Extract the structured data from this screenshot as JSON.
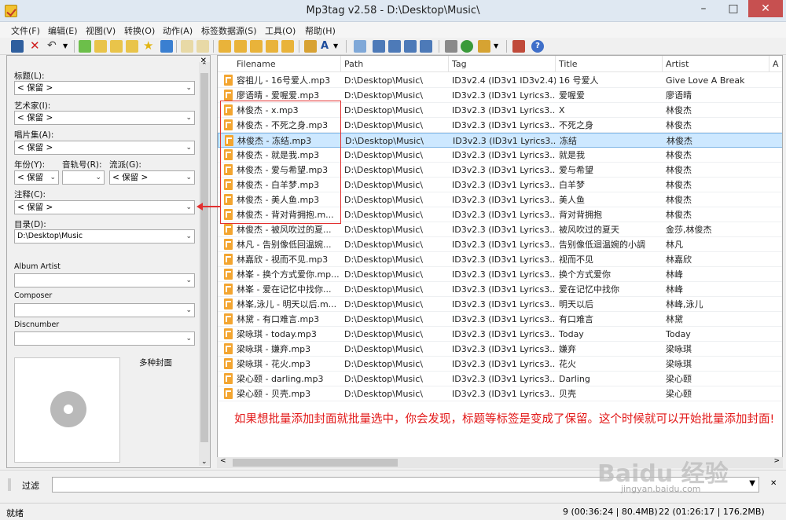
{
  "window": {
    "title": "Mp3tag v2.58  -  D:\\Desktop\\Music\\"
  },
  "menu": [
    "文件(F)",
    "编辑(E)",
    "视图(V)",
    "转换(O)",
    "动作(A)",
    "标签数据源(S)",
    "工具(O)",
    "帮助(H)"
  ],
  "tag_panel": {
    "title_label": "标题(L):",
    "title_value": "< 保留 >",
    "artist_label": "艺术家(I):",
    "artist_value": "< 保留 >",
    "album_label": "唱片集(A):",
    "album_value": "< 保留 >",
    "year_label": "年份(Y):",
    "year_value": "< 保留",
    "track_label": "音轨号(R):",
    "track_value": "",
    "genre_label": "流派(G):",
    "genre_value": "< 保留 >",
    "comment_label": "注释(C):",
    "comment_value": "< 保留 >",
    "dir_label": "目录(D):",
    "dir_value": "D:\\Desktop\\Music",
    "album_artist_label": "Album Artist",
    "album_artist_value": "",
    "composer_label": "Composer",
    "composer_value": "",
    "discnumber_label": "Discnumber",
    "discnumber_value": "",
    "cover_label": "多种封面"
  },
  "file_list": {
    "columns": [
      "Filename",
      "Path",
      "Tag",
      "Title",
      "Artist",
      "A"
    ],
    "rows": [
      {
        "filename": "容祖儿 - 16号爱人.mp3",
        "path": "D:\\Desktop\\Music\\",
        "tag": "ID3v2.4 (ID3v1 ID3v2.4)",
        "title": "16 号爱人",
        "artist": "Give Love A Break",
        "selected": false
      },
      {
        "filename": "廖语晴 - 爱喔爱.mp3",
        "path": "D:\\Desktop\\Music\\",
        "tag": "ID3v2.3 (ID3v1 Lyrics3...",
        "title": "爱喔爱",
        "artist": "廖语晴",
        "selected": false
      },
      {
        "filename": "林俊杰 - x.mp3",
        "path": "D:\\Desktop\\Music\\",
        "tag": "ID3v2.3 (ID3v1 Lyrics3...",
        "title": "X",
        "artist": "林俊杰",
        "selected": false
      },
      {
        "filename": "林俊杰 - 不死之身.mp3",
        "path": "D:\\Desktop\\Music\\",
        "tag": "ID3v2.3 (ID3v1 Lyrics3...",
        "title": "不死之身",
        "artist": "林俊杰",
        "selected": false
      },
      {
        "filename": "林俊杰 - 冻结.mp3",
        "path": "D:\\Desktop\\Music\\",
        "tag": "ID3v2.3 (ID3v1 Lyrics3...",
        "title": "冻结",
        "artist": "林俊杰",
        "selected": true
      },
      {
        "filename": "林俊杰 - 就是我.mp3",
        "path": "D:\\Desktop\\Music\\",
        "tag": "ID3v2.3 (ID3v1 Lyrics3...",
        "title": "就是我",
        "artist": "林俊杰",
        "selected": false
      },
      {
        "filename": "林俊杰 - 爱与希望.mp3",
        "path": "D:\\Desktop\\Music\\",
        "tag": "ID3v2.3 (ID3v1 Lyrics3...",
        "title": "爱与希望",
        "artist": "林俊杰",
        "selected": false
      },
      {
        "filename": "林俊杰 - 白羊梦.mp3",
        "path": "D:\\Desktop\\Music\\",
        "tag": "ID3v2.3 (ID3v1 Lyrics3...",
        "title": "白羊梦",
        "artist": "林俊杰",
        "selected": false
      },
      {
        "filename": "林俊杰 - 美人鱼.mp3",
        "path": "D:\\Desktop\\Music\\",
        "tag": "ID3v2.3 (ID3v1 Lyrics3...",
        "title": "美人鱼",
        "artist": "林俊杰",
        "selected": false
      },
      {
        "filename": "林俊杰 - 背对背拥抱.m...",
        "path": "D:\\Desktop\\Music\\",
        "tag": "ID3v2.3 (ID3v1 Lyrics3...",
        "title": "背对背拥抱",
        "artist": "林俊杰",
        "selected": false
      },
      {
        "filename": "林俊杰 - 被风吹过的夏...",
        "path": "D:\\Desktop\\Music\\",
        "tag": "ID3v2.3 (ID3v1 Lyrics3...",
        "title": "被风吹过的夏天",
        "artist": "金莎,林俊杰",
        "selected": false
      },
      {
        "filename": "林凡 - 告别像低回温婉...",
        "path": "D:\\Desktop\\Music\\",
        "tag": "ID3v2.3 (ID3v1 Lyrics3...",
        "title": "告别像低迴温婉的小調",
        "artist": "林凡",
        "selected": false
      },
      {
        "filename": "林嘉欣 - 视而不见.mp3",
        "path": "D:\\Desktop\\Music\\",
        "tag": "ID3v2.3 (ID3v1 Lyrics3...",
        "title": "视而不见",
        "artist": "林嘉欣",
        "selected": false
      },
      {
        "filename": "林峯 - 换个方式爱你.mp...",
        "path": "D:\\Desktop\\Music\\",
        "tag": "ID3v2.3 (ID3v1 Lyrics3...",
        "title": "换个方式爱你",
        "artist": "林峰",
        "selected": false
      },
      {
        "filename": "林峯 - 爱在记忆中找你...",
        "path": "D:\\Desktop\\Music\\",
        "tag": "ID3v2.3 (ID3v1 Lyrics3...",
        "title": "爱在记忆中找你",
        "artist": "林峰",
        "selected": false
      },
      {
        "filename": "林峯,泳儿 - 明天以后.m...",
        "path": "D:\\Desktop\\Music\\",
        "tag": "ID3v2.3 (ID3v1 Lyrics3...",
        "title": "明天以后",
        "artist": "林峰,泳儿",
        "selected": false
      },
      {
        "filename": "林黛 - 有口难言.mp3",
        "path": "D:\\Desktop\\Music\\",
        "tag": "ID3v2.3 (ID3v1 Lyrics3...",
        "title": "有口难言",
        "artist": "林黛",
        "selected": false
      },
      {
        "filename": "梁咏琪 - today.mp3",
        "path": "D:\\Desktop\\Music\\",
        "tag": "ID3v2.3 (ID3v1 Lyrics3...",
        "title": "Today",
        "artist": "Today",
        "selected": false
      },
      {
        "filename": "梁咏琪 - 嫌弃.mp3",
        "path": "D:\\Desktop\\Music\\",
        "tag": "ID3v2.3 (ID3v1 Lyrics3...",
        "title": "嫌弃",
        "artist": "梁咏琪",
        "selected": false
      },
      {
        "filename": "梁咏琪 - 花火.mp3",
        "path": "D:\\Desktop\\Music\\",
        "tag": "ID3v2.3 (ID3v1 Lyrics3...",
        "title": "花火",
        "artist": "梁咏琪",
        "selected": false
      },
      {
        "filename": "梁心颐 - darling.mp3",
        "path": "D:\\Desktop\\Music\\",
        "tag": "ID3v2.3 (ID3v1 Lyrics3...",
        "title": "Darling",
        "artist": "梁心颐",
        "selected": false
      },
      {
        "filename": "梁心颐 - 贝壳.mp3",
        "path": "D:\\Desktop\\Music\\",
        "tag": "ID3v2.3 (ID3v1 Lyrics3...",
        "title": "贝壳",
        "artist": "梁心颐",
        "selected": false
      }
    ]
  },
  "annotation": "如果想批量添加封面就批量选中，你会发现，标题等标签是变成了保留。这个时候就可以开始批量添加封面!",
  "filter": {
    "label": "过滤",
    "value": ""
  },
  "status": {
    "left": "就绪",
    "selection": "9 (00:36:24 | 80.4MB)",
    "total": "22 (01:26:17 | 176.2MB)"
  },
  "watermark": {
    "text": "Baidu 经验",
    "sub": "jingyan.baidu.com"
  },
  "colors": {
    "accent_red": "#e23030",
    "selection": "#cde8ff",
    "file_icon": "#f3a530"
  }
}
